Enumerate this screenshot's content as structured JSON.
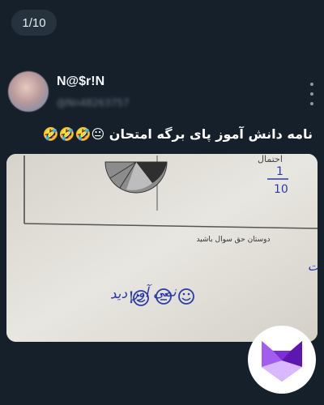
{
  "gallery": {
    "counter": "1/10"
  },
  "author": {
    "display_name": "N@$r!N",
    "handle": "@Nn48263757"
  },
  "post": {
    "text": "نامه دانش آموز پای برگه امتحان 😐🤣🤣🤣",
    "emoji_icons": [
      "neutral-face-icon",
      "rolling-on-floor-laughing-icon"
    ]
  },
  "photo": {
    "fraction": {
      "numerator": "1",
      "denominator": "10"
    },
    "side_label": "احتمال",
    "note_header": "دوستان حق سوال باشید",
    "note_line1": "شما اگر میخواستیر موفق شویم این همه سوالات سخت",
    "note_line2": "نمی آور دید",
    "smileys": [
      "smiley-icon",
      "neutral-face-icon",
      "smiley-icon"
    ]
  },
  "colors": {
    "background": "#15202b",
    "counter_bg": "#26323d",
    "ink": "#2b3aa8",
    "logo_purple": "#7c2dd6"
  }
}
